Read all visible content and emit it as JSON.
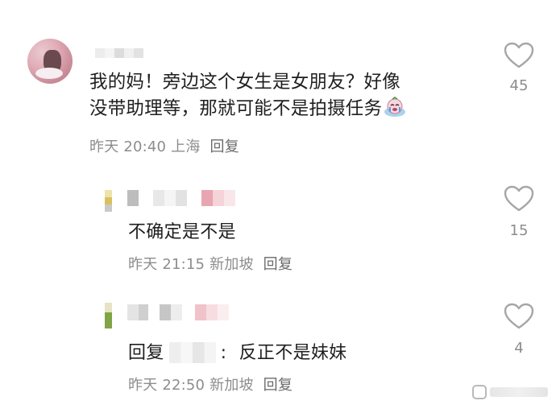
{
  "comment": {
    "text_line1": "我的妈！旁边这个女生是女朋友？好像",
    "text_line2": "没带助理等，那就可能不是拍摄任务",
    "sticker_icon": "crying-emoji-sticker",
    "time": "昨天 20:40",
    "location": "上海",
    "reply_label": "回复",
    "like_count": "45"
  },
  "replies": [
    {
      "text": "不确定是不是",
      "time": "昨天 21:15",
      "location": "新加坡",
      "reply_label": "回复",
      "like_count": "15"
    },
    {
      "reply_prefix": "回复",
      "separator": ":",
      "text": "反正不是妹妹",
      "time": "昨天 22:50",
      "location": "新加坡",
      "reply_label": "回复",
      "like_count": "4"
    }
  ],
  "icons": {
    "like": "heart-outline-icon"
  },
  "colors": {
    "text": "#1f1f1f",
    "meta": "#8d8d8d",
    "icon": "#a6a6a6"
  }
}
